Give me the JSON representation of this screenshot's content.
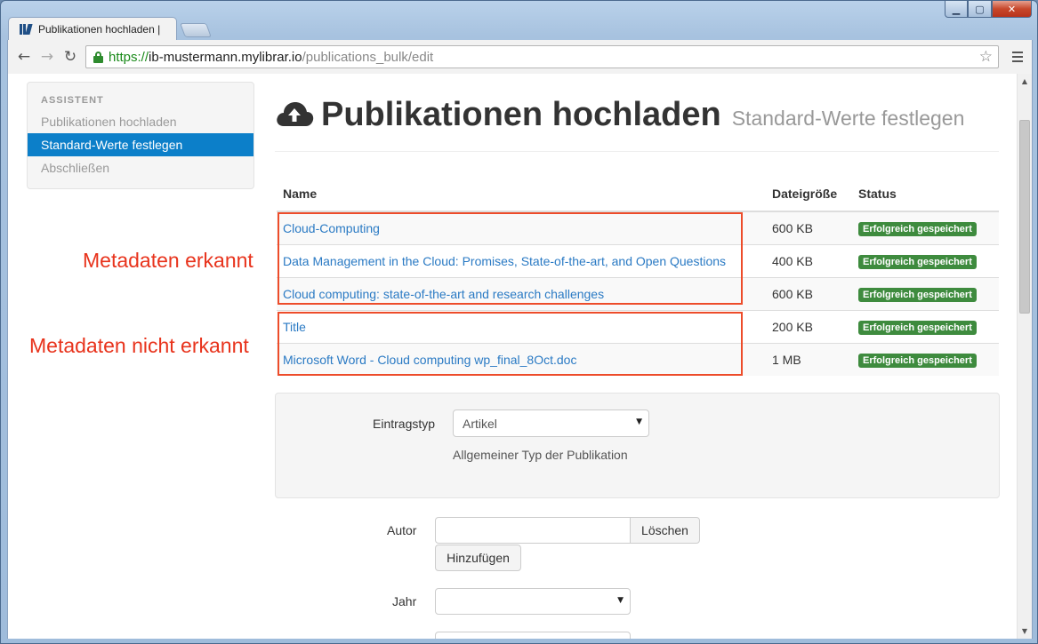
{
  "browser": {
    "tab_title": "Publikationen hochladen | ",
    "url_scheme": "https://",
    "url_host": "ib-mustermann.mylibrar.io",
    "url_path": "/publications_bulk/edit"
  },
  "sidebar": {
    "header": "ASSISTENT",
    "items": [
      {
        "label": "Publikationen hochladen",
        "active": false
      },
      {
        "label": "Standard-Werte festlegen",
        "active": true
      },
      {
        "label": "Abschließen",
        "active": false
      }
    ]
  },
  "page": {
    "title": "Publikationen hochladen",
    "subtitle": "Standard-Werte festlegen"
  },
  "table": {
    "headers": [
      "Name",
      "Dateigröße",
      "Status"
    ],
    "rows": [
      {
        "name": "Cloud-Computing",
        "size": "600 KB",
        "status": "Erfolgreich gespeichert"
      },
      {
        "name": "Data Management in the Cloud: Promises, State-of-the-art, and Open Questions",
        "size": "400 KB",
        "status": "Erfolgreich gespeichert"
      },
      {
        "name": "Cloud computing: state-of-the-art and research challenges",
        "size": "600 KB",
        "status": "Erfolgreich gespeichert"
      },
      {
        "name": "Title",
        "size": "200 KB",
        "status": "Erfolgreich gespeichert"
      },
      {
        "name": "Microsoft Word - Cloud computing wp_final_8Oct.doc",
        "size": "1 MB",
        "status": "Erfolgreich gespeichert"
      }
    ]
  },
  "annotations": {
    "recognized": "Metadaten erkannt",
    "not_recognized": "Metadaten nicht erkannt"
  },
  "form": {
    "entry_type_label": "Eintragstyp",
    "entry_type_value": "Artikel",
    "entry_type_help": "Allgemeiner Typ der Publikation",
    "author_label": "Autor",
    "author_value": "",
    "delete_button": "Löschen",
    "add_button": "Hinzufügen",
    "year_label": "Jahr",
    "year_value": ""
  },
  "colors": {
    "accent": "#0c7fc9",
    "success": "#3e8b3e",
    "annotation": "#ed4c2a",
    "link": "#2a7ac4"
  }
}
